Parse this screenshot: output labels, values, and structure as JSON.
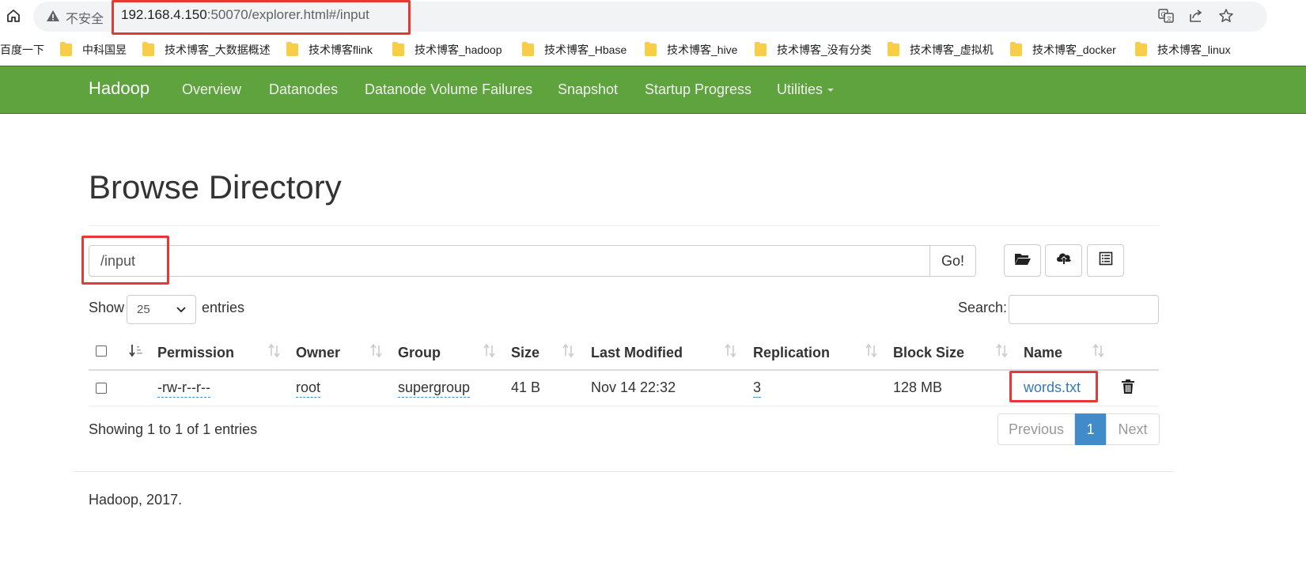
{
  "browser": {
    "security_label": "不安全",
    "url_host": "192.168.4.150",
    "url_rest": ":50070/explorer.html#/input"
  },
  "bookmarks": [
    {
      "label": "百度一下"
    },
    {
      "label": "中科国昱"
    },
    {
      "label": "技术博客_大数据概述"
    },
    {
      "label": "技术博客flink"
    },
    {
      "label": "技术博客_hadoop"
    },
    {
      "label": "技术博客_Hbase"
    },
    {
      "label": "技术博客_hive"
    },
    {
      "label": "技术博客_没有分类"
    },
    {
      "label": "技术博客_虚拟机"
    },
    {
      "label": "技术博客_docker"
    },
    {
      "label": "技术博客_linux"
    }
  ],
  "navbar": {
    "brand": "Hadoop",
    "items": [
      {
        "label": "Overview"
      },
      {
        "label": "Datanodes"
      },
      {
        "label": "Datanode Volume Failures"
      },
      {
        "label": "Snapshot"
      },
      {
        "label": "Startup Progress"
      },
      {
        "label": "Utilities"
      }
    ],
    "color": "#5fa33e"
  },
  "main": {
    "title": "Browse Directory",
    "path_value": "/input",
    "go_label": "Go!",
    "show_label": "Show",
    "entries_value": "25",
    "entries_label": "entries",
    "search_label": "Search:",
    "search_value": ""
  },
  "table": {
    "headers": [
      "Permission",
      "Owner",
      "Group",
      "Size",
      "Last Modified",
      "Replication",
      "Block Size",
      "Name"
    ],
    "rows": [
      {
        "permission": "-rw-r--r--",
        "owner": "root",
        "group": "supergroup",
        "size": "41 B",
        "last_modified": "Nov 14 22:32",
        "replication": "3",
        "block_size": "128 MB",
        "name": "words.txt"
      }
    ]
  },
  "pagination": {
    "info": "Showing 1 to 1 of 1 entries",
    "previous": "Previous",
    "current": "1",
    "next": "Next",
    "active_color": "#428bca"
  },
  "footer": {
    "text": "Hadoop, 2017."
  },
  "annotation_color": "#e53935"
}
